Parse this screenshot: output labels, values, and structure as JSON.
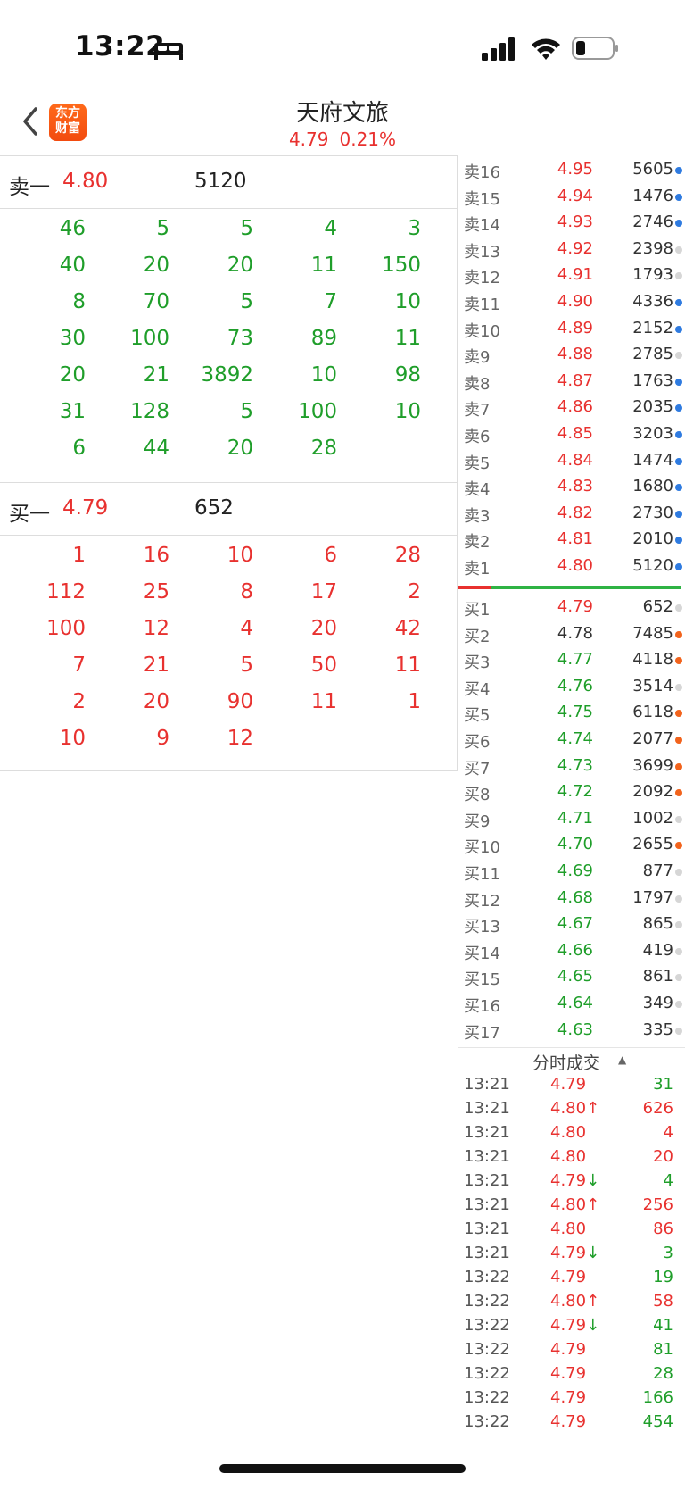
{
  "status_bar": {
    "time": "13:22"
  },
  "header": {
    "title": "天府文旅",
    "price": "4.79",
    "change_pct": "0.21%",
    "logo_line1": "东方",
    "logo_line2": "财富"
  },
  "sell_level": {
    "label": "卖一",
    "price": "4.80",
    "volume": "5120",
    "queue": [
      [
        "46",
        "5",
        "5",
        "4",
        "3"
      ],
      [
        "40",
        "20",
        "20",
        "11",
        "150"
      ],
      [
        "8",
        "70",
        "5",
        "7",
        "10"
      ],
      [
        "30",
        "100",
        "73",
        "89",
        "11"
      ],
      [
        "20",
        "21",
        "3892",
        "10",
        "98"
      ],
      [
        "31",
        "128",
        "5",
        "100",
        "10"
      ],
      [
        "6",
        "44",
        "20",
        "28",
        ""
      ]
    ]
  },
  "buy_level": {
    "label": "买一",
    "price": "4.79",
    "volume": "652",
    "queue": [
      [
        "1",
        "16",
        "10",
        "6",
        "28"
      ],
      [
        "112",
        "25",
        "8",
        "17",
        "2"
      ],
      [
        "100",
        "12",
        "4",
        "20",
        "42"
      ],
      [
        "7",
        "21",
        "5",
        "50",
        "11"
      ],
      [
        "2",
        "20",
        "90",
        "11",
        "1"
      ],
      [
        "10",
        "9",
        "12",
        "",
        ""
      ]
    ]
  },
  "order_book": {
    "asks": [
      {
        "label": "卖16",
        "price": "4.95",
        "volume": "5605",
        "dot": "blue"
      },
      {
        "label": "卖15",
        "price": "4.94",
        "volume": "1476",
        "dot": "blue"
      },
      {
        "label": "卖14",
        "price": "4.93",
        "volume": "2746",
        "dot": "blue"
      },
      {
        "label": "卖13",
        "price": "4.92",
        "volume": "2398",
        "dot": "gray"
      },
      {
        "label": "卖12",
        "price": "4.91",
        "volume": "1793",
        "dot": "gray"
      },
      {
        "label": "卖11",
        "price": "4.90",
        "volume": "4336",
        "dot": "blue"
      },
      {
        "label": "卖10",
        "price": "4.89",
        "volume": "2152",
        "dot": "blue"
      },
      {
        "label": "卖9",
        "price": "4.88",
        "volume": "2785",
        "dot": "gray"
      },
      {
        "label": "卖8",
        "price": "4.87",
        "volume": "1763",
        "dot": "blue"
      },
      {
        "label": "卖7",
        "price": "4.86",
        "volume": "2035",
        "dot": "blue"
      },
      {
        "label": "卖6",
        "price": "4.85",
        "volume": "3203",
        "dot": "blue"
      },
      {
        "label": "卖5",
        "price": "4.84",
        "volume": "1474",
        "dot": "blue"
      },
      {
        "label": "卖4",
        "price": "4.83",
        "volume": "1680",
        "dot": "blue"
      },
      {
        "label": "卖3",
        "price": "4.82",
        "volume": "2730",
        "dot": "blue"
      },
      {
        "label": "卖2",
        "price": "4.81",
        "volume": "2010",
        "dot": "blue"
      },
      {
        "label": "卖1",
        "price": "4.80",
        "volume": "5120",
        "dot": "blue"
      }
    ],
    "bids": [
      {
        "label": "买1",
        "price": "4.79",
        "volume": "652",
        "dot": "gray",
        "pcolor": "red"
      },
      {
        "label": "买2",
        "price": "4.78",
        "volume": "7485",
        "dot": "orange",
        "pcolor": "dark"
      },
      {
        "label": "买3",
        "price": "4.77",
        "volume": "4118",
        "dot": "orange",
        "pcolor": "green"
      },
      {
        "label": "买4",
        "price": "4.76",
        "volume": "3514",
        "dot": "gray",
        "pcolor": "green"
      },
      {
        "label": "买5",
        "price": "4.75",
        "volume": "6118",
        "dot": "orange",
        "pcolor": "green"
      },
      {
        "label": "买6",
        "price": "4.74",
        "volume": "2077",
        "dot": "orange",
        "pcolor": "green"
      },
      {
        "label": "买7",
        "price": "4.73",
        "volume": "3699",
        "dot": "orange",
        "pcolor": "green"
      },
      {
        "label": "买8",
        "price": "4.72",
        "volume": "2092",
        "dot": "orange",
        "pcolor": "green"
      },
      {
        "label": "买9",
        "price": "4.71",
        "volume": "1002",
        "dot": "gray",
        "pcolor": "green"
      },
      {
        "label": "买10",
        "price": "4.70",
        "volume": "2655",
        "dot": "orange",
        "pcolor": "green"
      },
      {
        "label": "买11",
        "price": "4.69",
        "volume": "877",
        "dot": "gray",
        "pcolor": "green"
      },
      {
        "label": "买12",
        "price": "4.68",
        "volume": "1797",
        "dot": "gray",
        "pcolor": "green"
      },
      {
        "label": "买13",
        "price": "4.67",
        "volume": "865",
        "dot": "gray",
        "pcolor": "green"
      },
      {
        "label": "买14",
        "price": "4.66",
        "volume": "419",
        "dot": "gray",
        "pcolor": "green"
      },
      {
        "label": "买15",
        "price": "4.65",
        "volume": "861",
        "dot": "gray",
        "pcolor": "green"
      },
      {
        "label": "买16",
        "price": "4.64",
        "volume": "349",
        "dot": "gray",
        "pcolor": "green"
      },
      {
        "label": "买17",
        "price": "4.63",
        "volume": "335",
        "dot": "gray",
        "pcolor": "green"
      }
    ]
  },
  "trades": {
    "title": "分时成交",
    "rows": [
      {
        "time": "13:21",
        "price": "4.79",
        "arrow": "",
        "volume": "31",
        "vcolor": "green"
      },
      {
        "time": "13:21",
        "price": "4.80",
        "arrow": "↑",
        "volume": "626",
        "vcolor": "red"
      },
      {
        "time": "13:21",
        "price": "4.80",
        "arrow": "",
        "volume": "4",
        "vcolor": "red"
      },
      {
        "time": "13:21",
        "price": "4.80",
        "arrow": "",
        "volume": "20",
        "vcolor": "red"
      },
      {
        "time": "13:21",
        "price": "4.79",
        "arrow": "↓",
        "volume": "4",
        "vcolor": "green"
      },
      {
        "time": "13:21",
        "price": "4.80",
        "arrow": "↑",
        "volume": "256",
        "vcolor": "red"
      },
      {
        "time": "13:21",
        "price": "4.80",
        "arrow": "",
        "volume": "86",
        "vcolor": "red"
      },
      {
        "time": "13:21",
        "price": "4.79",
        "arrow": "↓",
        "volume": "3",
        "vcolor": "green"
      },
      {
        "time": "13:22",
        "price": "4.79",
        "arrow": "",
        "volume": "19",
        "vcolor": "green"
      },
      {
        "time": "13:22",
        "price": "4.80",
        "arrow": "↑",
        "volume": "58",
        "vcolor": "red"
      },
      {
        "time": "13:22",
        "price": "4.79",
        "arrow": "↓",
        "volume": "41",
        "vcolor": "green"
      },
      {
        "time": "13:22",
        "price": "4.79",
        "arrow": "",
        "volume": "81",
        "vcolor": "green"
      },
      {
        "time": "13:22",
        "price": "4.79",
        "arrow": "",
        "volume": "28",
        "vcolor": "green"
      },
      {
        "time": "13:22",
        "price": "4.79",
        "arrow": "",
        "volume": "166",
        "vcolor": "green"
      },
      {
        "time": "13:22",
        "price": "4.79",
        "arrow": "",
        "volume": "454",
        "vcolor": "green"
      }
    ]
  }
}
